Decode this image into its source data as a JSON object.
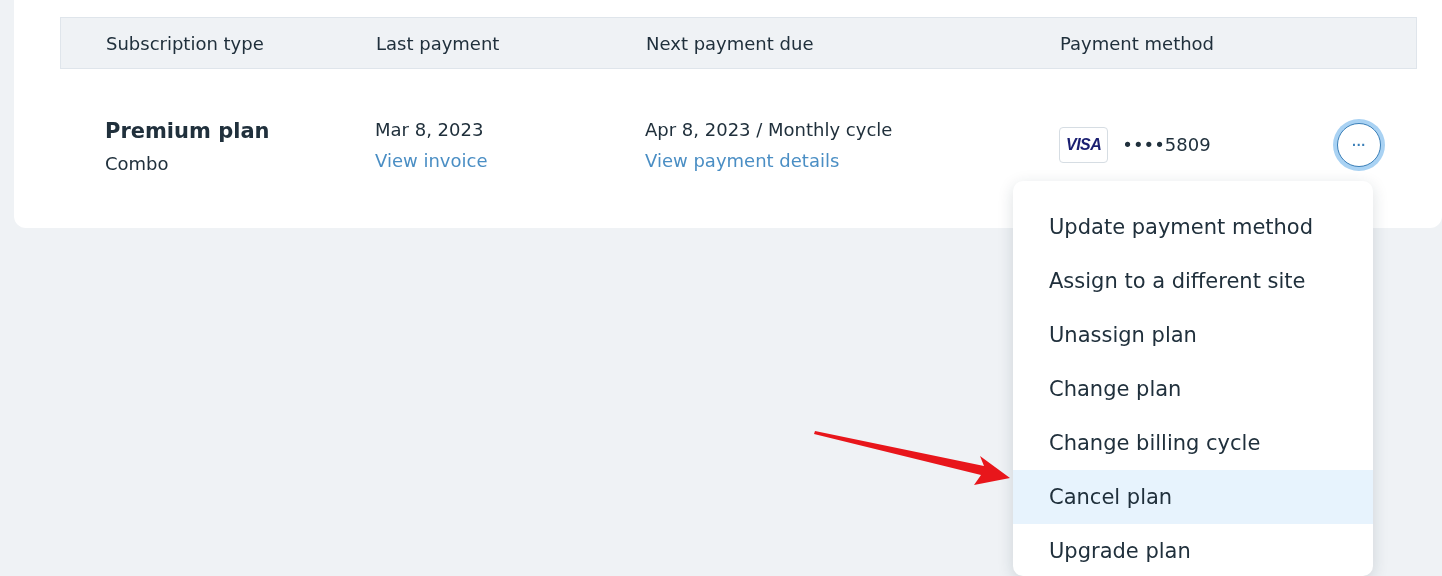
{
  "table": {
    "columns": [
      "Subscription type",
      "Last payment",
      "Next payment due",
      "Payment method"
    ],
    "rows": [
      {
        "plan": "Premium plan",
        "plan_type": "Combo",
        "last_payment": "Mar 8, 2023",
        "last_link": "View invoice",
        "next_payment": "Apr 8, 2023 / Monthly cycle",
        "next_link": "View payment details",
        "card_brand": "VISA",
        "card_number": "••••5809",
        "more_button": "···"
      }
    ]
  },
  "menu": {
    "items": [
      {
        "label": "Update payment method",
        "selected": false
      },
      {
        "label": "Assign to a different site",
        "selected": false
      },
      {
        "label": "Unassign plan",
        "selected": false
      },
      {
        "label": "Change plan",
        "selected": false
      },
      {
        "label": "Change billing cycle",
        "selected": false
      },
      {
        "label": "Cancel plan",
        "selected": true
      },
      {
        "label": "Upgrade plan",
        "selected": false
      }
    ]
  }
}
